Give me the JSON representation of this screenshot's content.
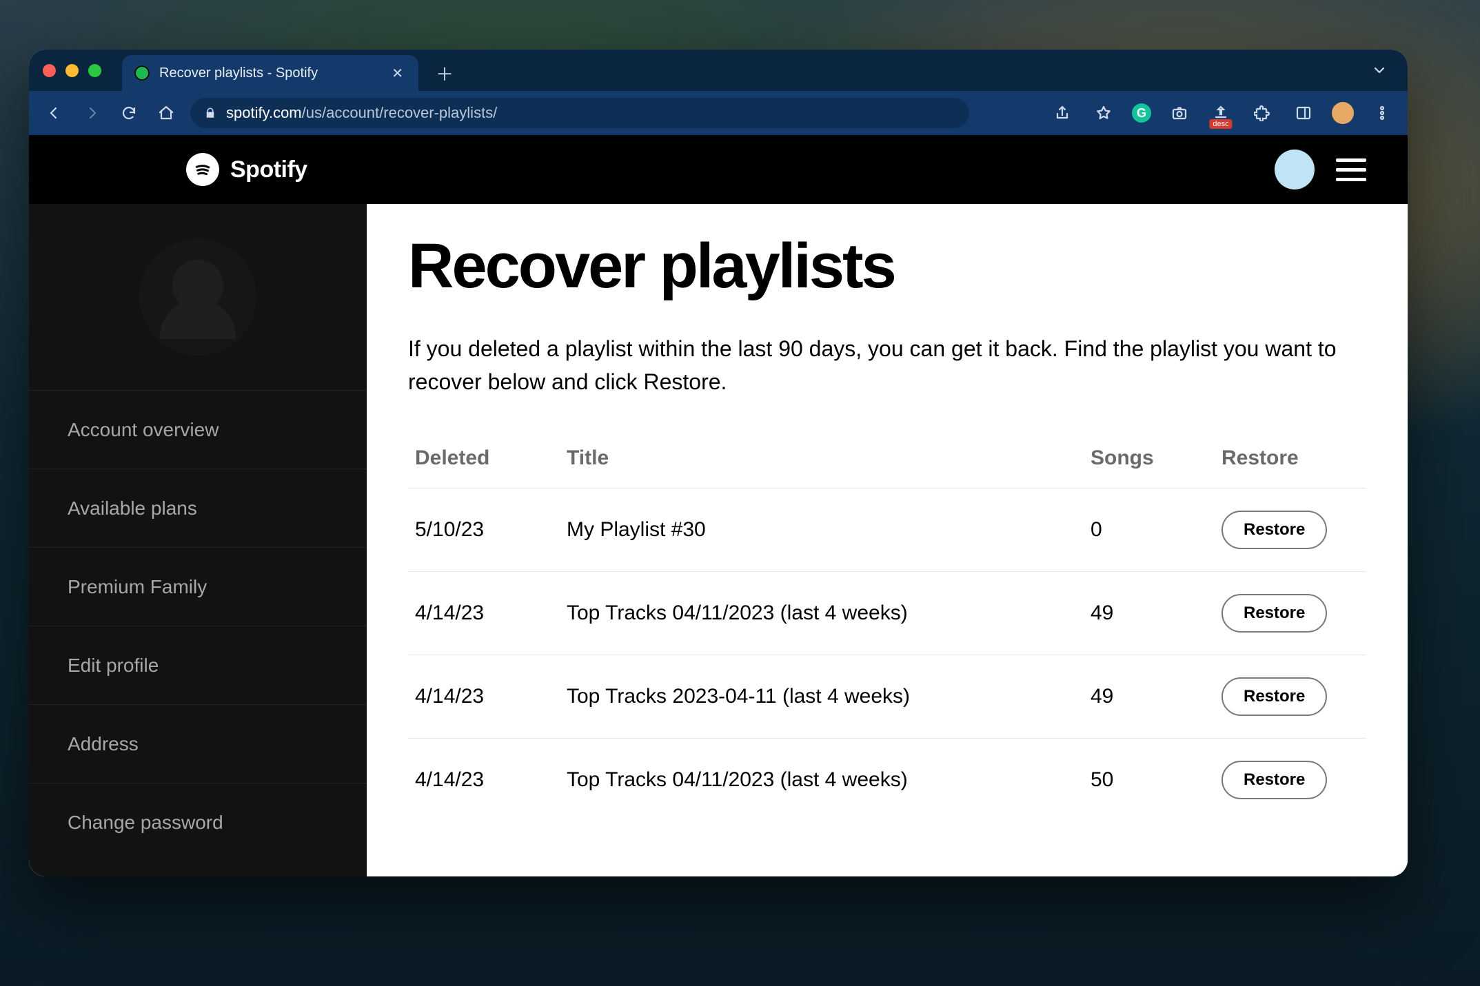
{
  "browser": {
    "tab_title": "Recover playlists - Spotify",
    "url_domain": "spotify.com",
    "url_path": "/us/account/recover-playlists/",
    "ext_desc_label": "desc"
  },
  "header": {
    "brand": "Spotify"
  },
  "sidebar": {
    "items": [
      {
        "label": "Account overview"
      },
      {
        "label": "Available plans"
      },
      {
        "label": "Premium Family"
      },
      {
        "label": "Edit profile"
      },
      {
        "label": "Address"
      },
      {
        "label": "Change password"
      }
    ]
  },
  "main": {
    "title": "Recover playlists",
    "description": "If you deleted a playlist within the last 90 days, you can get it back. Find the playlist you want to recover below and click Restore.",
    "columns": {
      "deleted": "Deleted",
      "title": "Title",
      "songs": "Songs",
      "restore": "Restore"
    },
    "restore_label": "Restore",
    "rows": [
      {
        "deleted": "5/10/23",
        "title": "My Playlist #30",
        "songs": "0"
      },
      {
        "deleted": "4/14/23",
        "title": "Top Tracks 04/11/2023 (last 4 weeks)",
        "songs": "49"
      },
      {
        "deleted": "4/14/23",
        "title": "Top Tracks 2023-04-11 (last 4 weeks)",
        "songs": "49"
      },
      {
        "deleted": "4/14/23",
        "title": "Top Tracks 04/11/2023 (last 4 weeks)",
        "songs": "50"
      }
    ]
  }
}
